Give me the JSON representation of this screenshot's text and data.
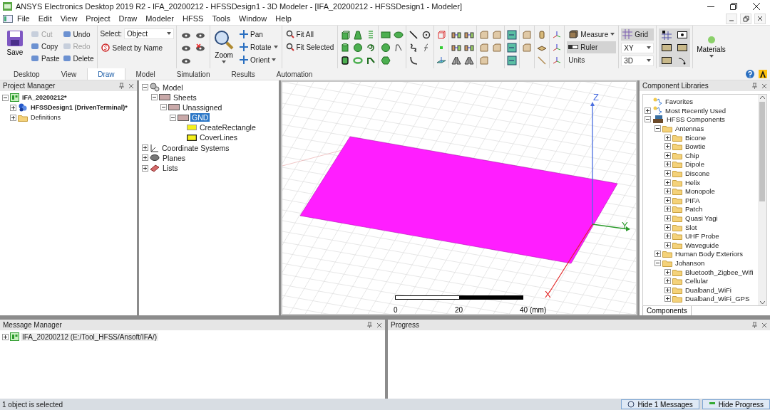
{
  "window": {
    "title": "ANSYS Electronics Desktop 2019 R2 - IFA_20200212 - HFSSDesign1 - 3D Modeler - [IFA_20200212 - HFSSDesign1 - Modeler]"
  },
  "menu": [
    "File",
    "Edit",
    "View",
    "Project",
    "Draw",
    "Modeler",
    "HFSS",
    "Tools",
    "Window",
    "Help"
  ],
  "ribbon": {
    "save": "Save",
    "edit": [
      {
        "label": "Cut",
        "disabled": true
      },
      {
        "label": "Copy",
        "disabled": false
      },
      {
        "label": "Paste",
        "disabled": false
      },
      {
        "label": "Undo",
        "disabled": false
      },
      {
        "label": "Redo",
        "disabled": true
      },
      {
        "label": "Delete",
        "disabled": false
      }
    ],
    "select_label": "Select:",
    "select_value": "Object",
    "select_by_name": "Select by Name",
    "zoom": "Zoom",
    "view": [
      {
        "label": "Pan",
        "dropdown": false
      },
      {
        "label": "Rotate",
        "dropdown": true
      },
      {
        "label": "Orient",
        "dropdown": true
      }
    ],
    "fit": [
      "Fit All",
      "Fit Selected"
    ],
    "measure": "Measure",
    "ruler": {
      "label": "Ruler",
      "on": true
    },
    "units": "Units",
    "grid": {
      "label": "Grid",
      "on": true
    },
    "plane": "XY",
    "view_mode": "3D",
    "materials": "Materials"
  },
  "ribbon_tabs": [
    {
      "label": "Desktop",
      "selected": false
    },
    {
      "label": "View",
      "selected": false
    },
    {
      "label": "Draw",
      "selected": true
    },
    {
      "label": "Model",
      "selected": false
    },
    {
      "label": "Simulation",
      "selected": false
    },
    {
      "label": "Results",
      "selected": false
    },
    {
      "label": "Automation",
      "selected": false
    }
  ],
  "project_manager": {
    "title": "Project Manager",
    "tree": [
      {
        "label": "IFA_20200212*",
        "kind": "project",
        "bold": true,
        "expanded": true,
        "children": [
          {
            "label": "HFSSDesign1 (DrivenTerminal)*",
            "kind": "design",
            "bold": true,
            "expanded": false
          },
          {
            "label": "Definitions",
            "kind": "folder",
            "bold": false,
            "expanded": false
          }
        ]
      }
    ]
  },
  "model_tree": [
    {
      "label": "Model",
      "kind": "model",
      "expanded": true,
      "selected": false,
      "children": [
        {
          "label": "Sheets",
          "kind": "sheet",
          "expanded": true,
          "selected": false,
          "children": [
            {
              "label": "Unassigned",
              "kind": "sheet",
              "expanded": true,
              "selected": false,
              "children": [
                {
                  "label": "GND",
                  "kind": "sheet",
                  "expanded": true,
                  "selected": true,
                  "children": [
                    {
                      "label": "CreateRectangle",
                      "kind": "operation",
                      "selected": false
                    },
                    {
                      "label": "CoverLines",
                      "kind": "cover",
                      "selected": false
                    }
                  ]
                }
              ]
            }
          ]
        }
      ]
    },
    {
      "label": "Coordinate Systems",
      "kind": "axes",
      "expanded": false,
      "selected": false
    },
    {
      "label": "Planes",
      "kind": "planes",
      "expanded": false,
      "selected": false
    },
    {
      "label": "Lists",
      "kind": "lists",
      "expanded": false,
      "selected": false
    }
  ],
  "viewport": {
    "axes": [
      "Z",
      "Y",
      "X"
    ],
    "scale": [
      "0",
      "20",
      "40 (mm)"
    ]
  },
  "component_libraries": {
    "title": "Component Libraries",
    "tab": "Components",
    "tree": [
      {
        "label": "Favorites",
        "kind": "favorites"
      },
      {
        "label": "Most Recently Used",
        "kind": "favorites",
        "expanded": false
      },
      {
        "label": "HFSS Components",
        "kind": "components",
        "expanded": true,
        "children": [
          {
            "label": "Antennas",
            "kind": "folder",
            "expanded": true,
            "children": [
              {
                "label": "Bicone",
                "kind": "folder",
                "expanded": false
              },
              {
                "label": "Bowtie",
                "kind": "folder",
                "expanded": false
              },
              {
                "label": "Chip",
                "kind": "folder",
                "expanded": false
              },
              {
                "label": "Dipole",
                "kind": "folder",
                "expanded": false
              },
              {
                "label": "Discone",
                "kind": "folder",
                "expanded": false
              },
              {
                "label": "Helix",
                "kind": "folder",
                "expanded": false
              },
              {
                "label": "Monopole",
                "kind": "folder",
                "expanded": false
              },
              {
                "label": "PIFA",
                "kind": "folder",
                "expanded": false
              },
              {
                "label": "Patch",
                "kind": "folder",
                "expanded": false
              },
              {
                "label": "Quasi Yagi",
                "kind": "folder",
                "expanded": false
              },
              {
                "label": "Slot",
                "kind": "folder",
                "expanded": false
              },
              {
                "label": "UHF Probe",
                "kind": "folder",
                "expanded": false
              },
              {
                "label": "Waveguide",
                "kind": "folder",
                "expanded": false
              }
            ]
          },
          {
            "label": "Human Body Exteriors",
            "kind": "folder",
            "expanded": false
          },
          {
            "label": "Johanson",
            "kind": "folder",
            "expanded": true,
            "children": [
              {
                "label": "Bluetooth_Zigbee_Wifi",
                "kind": "folder",
                "expanded": false
              },
              {
                "label": "Cellular",
                "kind": "folder",
                "expanded": false
              },
              {
                "label": "Dualband_WiFi",
                "kind": "folder",
                "expanded": false
              },
              {
                "label": "Dualband_WiFi_GPS",
                "kind": "folder",
                "expanded": false
              }
            ]
          }
        ]
      }
    ]
  },
  "message_manager": {
    "title": "Message Manager",
    "items": [
      {
        "label": "IFA_20200212 (E:/Tool_HFSS/Ansoft/IFA/)",
        "expanded": false
      }
    ]
  },
  "progress": {
    "title": "Progress"
  },
  "status_bar": {
    "text": "1 object is selected",
    "buttons": [
      "Hide 1 Messages",
      "Hide Progress"
    ]
  }
}
